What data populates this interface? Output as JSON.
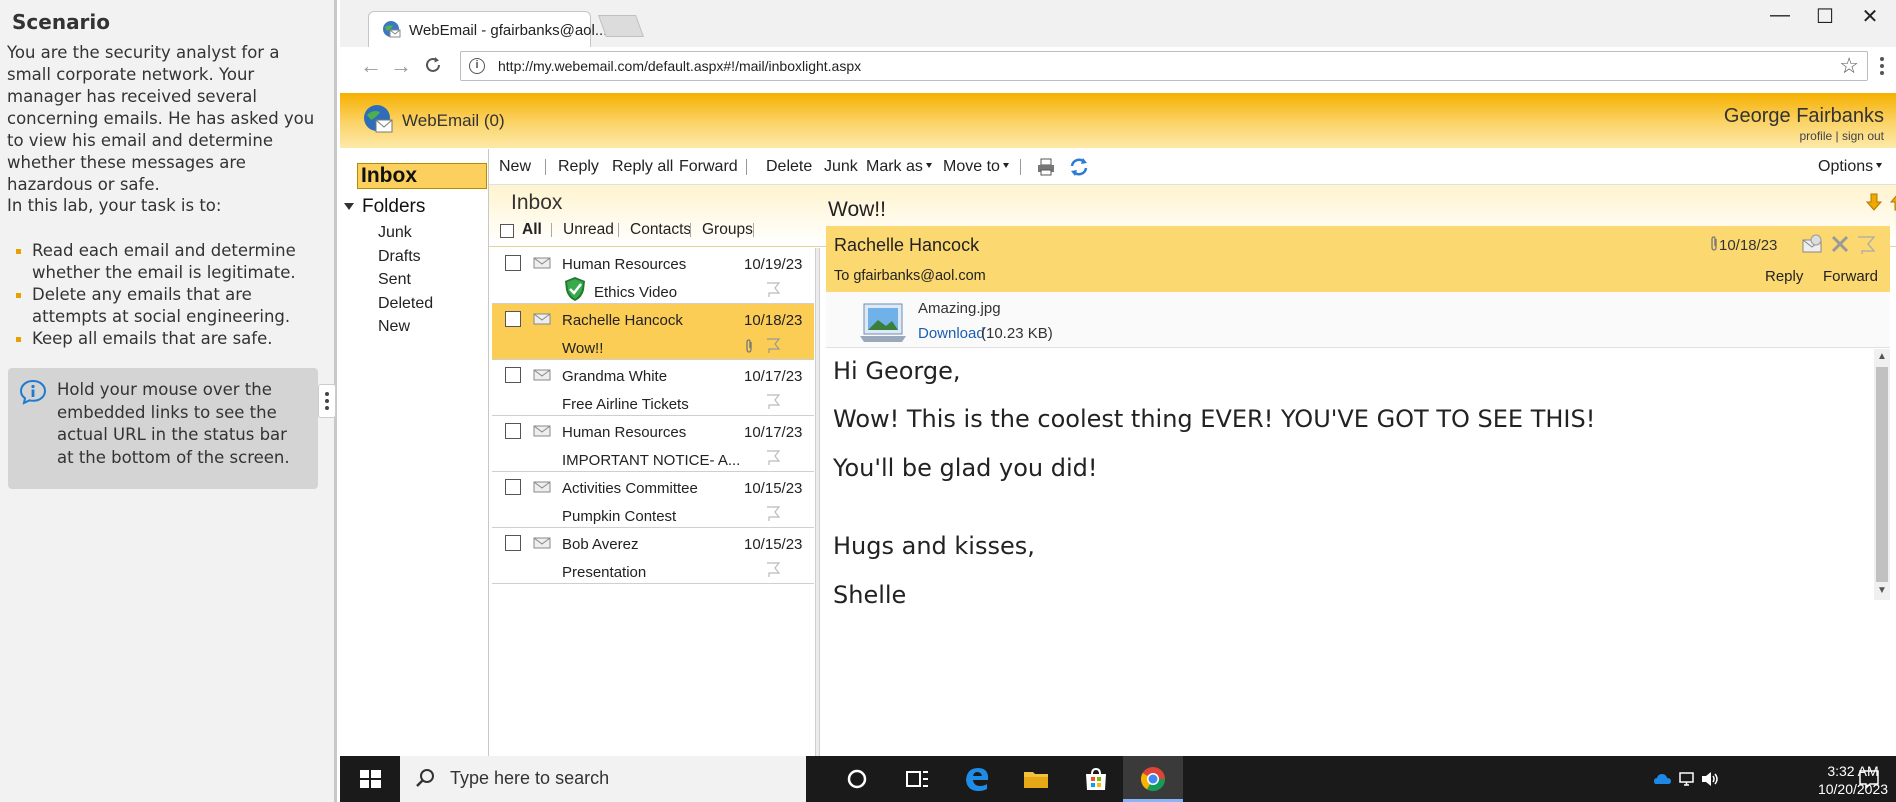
{
  "scenario": {
    "title": "Scenario",
    "intro": "You are the security analyst for a small corporate network. Your manager has received several concerning emails. He has asked you to view his email and determine whether these messages are hazardous or safe.",
    "task_lead": "In this lab, your task is to:",
    "tasks": [
      "Read each email and determine whether the email is legitimate.",
      "Delete any emails that are attempts at social engineering.",
      "Keep all emails that are safe."
    ],
    "tip": "Hold your mouse over the embedded links to see the actual URL in the status bar at the bottom of the screen."
  },
  "browser": {
    "tab_title": "WebEmail - gfairbanks@aol....",
    "url": "http://my.webemail.com/default.aspx#!/mail/inboxlight.aspx",
    "window_controls": [
      "—",
      "☐",
      "✕"
    ]
  },
  "app": {
    "name": "WebEmail (0)",
    "user_name": "George Fairbanks",
    "user_links": "profile | sign out",
    "accent": "#fccd55"
  },
  "folders": {
    "inbox": "Inbox",
    "heading": "Folders",
    "items": [
      "Junk",
      "Drafts",
      "Sent",
      "Deleted",
      "New"
    ]
  },
  "toolbar": {
    "new": "New",
    "reply": "Reply",
    "reply_all": "Reply all",
    "forward": "Forward",
    "delete": "Delete",
    "junk": "Junk",
    "mark_as": "Mark as",
    "move_to": "Move to",
    "options": "Options"
  },
  "list": {
    "title": "Inbox",
    "filters": [
      "All",
      "Unread",
      "Contacts",
      "Groups"
    ],
    "messages": [
      {
        "from": "Human Resources",
        "date": "10/19/23",
        "subject": "Ethics Video",
        "selected": false
      },
      {
        "from": "Rachelle Hancock",
        "date": "10/18/23",
        "subject": "Wow!!",
        "selected": true
      },
      {
        "from": "Grandma White",
        "date": "10/17/23",
        "subject": "Free Airline Tickets",
        "selected": false
      },
      {
        "from": "Human Resources",
        "date": "10/17/23",
        "subject": "IMPORTANT NOTICE- A...",
        "selected": false
      },
      {
        "from": "Activities Committee",
        "date": "10/15/23",
        "subject": "Pumpkin Contest",
        "selected": false
      },
      {
        "from": "Bob Averez",
        "date": "10/15/23",
        "subject": "Presentation",
        "selected": false
      }
    ]
  },
  "reader": {
    "subject": "Wow!!",
    "from": "Rachelle Hancock",
    "date": "10/18/23",
    "to": "To gfairbanks@aol.com",
    "reply": "Reply",
    "forward": "Forward",
    "attachment_name": "Amazing.jpg",
    "download": "Download",
    "attachment_size": "(10.23 KB)",
    "body": [
      "Hi George,",
      "Wow! This is the coolest thing EVER! YOU'VE GOT TO SEE THIS!",
      "You'll be glad you did!",
      "Hugs and kisses,",
      "Shelle"
    ]
  },
  "taskbar": {
    "search_placeholder": "Type here to search",
    "time": "3:32 AM",
    "date": "10/20/2023"
  }
}
